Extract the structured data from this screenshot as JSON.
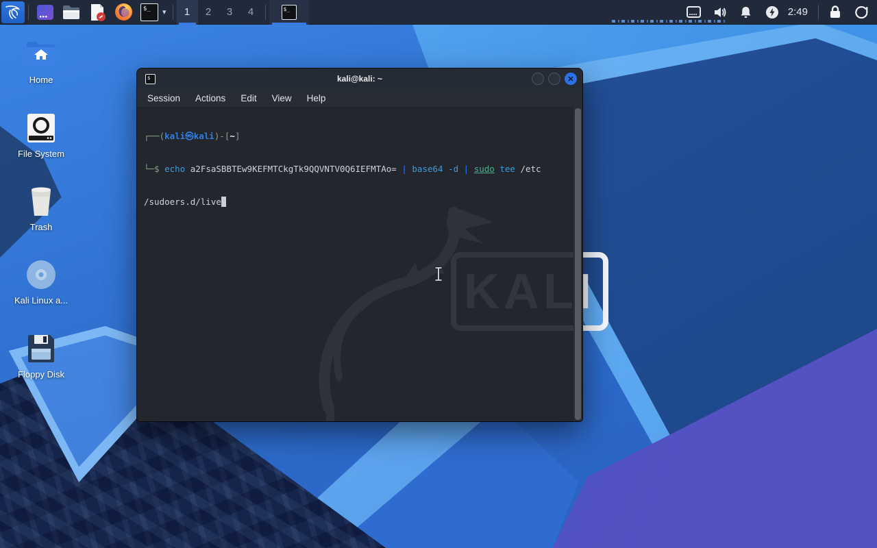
{
  "theme": {
    "panel_bg": "#212a3a",
    "accent_blue": "#3b79e8",
    "terminal_bg": "#23262d",
    "prompt_frame_color": "#85a287",
    "prompt_user_color": "#2f7fe0",
    "command_color": "#3f9bdc",
    "pipe_color": "#2563e0",
    "sudo_color": "#4fae8d",
    "wallpaper_blue": "#3173d3"
  },
  "panel": {
    "launchers": [
      {
        "name": "kali-menu"
      },
      {
        "name": "app-window"
      },
      {
        "name": "file-manager"
      },
      {
        "name": "text-editor"
      },
      {
        "name": "firefox"
      },
      {
        "name": "terminal"
      }
    ],
    "terminal_glyph": "$_",
    "workspaces": {
      "items": [
        {
          "label": "1"
        },
        {
          "label": "2"
        },
        {
          "label": "3"
        },
        {
          "label": "4"
        }
      ],
      "active": "1"
    },
    "clock": "2:49",
    "tray": [
      "network",
      "volume",
      "notifications",
      "power-manager",
      "lock",
      "logout"
    ]
  },
  "desktop": {
    "icons": [
      {
        "label": "Home"
      },
      {
        "label": "File System"
      },
      {
        "label": "Trash"
      },
      {
        "label": "Kali Linux a..."
      },
      {
        "label": "Floppy Disk"
      }
    ]
  },
  "window": {
    "title": "kali@kali: ~",
    "icon_glyph": "$",
    "menu": [
      {
        "label": "Session"
      },
      {
        "label": "Actions"
      },
      {
        "label": "Edit"
      },
      {
        "label": "View"
      },
      {
        "label": "Help"
      }
    ]
  },
  "terminal": {
    "lines": [
      {
        "segments": [
          {
            "text": "┌──(",
            "style": "frame"
          },
          {
            "text": "kali㉿kali",
            "style": "user"
          },
          {
            "text": ")-[",
            "style": "frame"
          },
          {
            "text": "~",
            "style": "dir"
          },
          {
            "text": "]",
            "style": "frame"
          }
        ]
      },
      {
        "segments": [
          {
            "text": "└─",
            "style": "frame"
          },
          {
            "text": "$ ",
            "style": "frame"
          },
          {
            "text": "echo ",
            "style": "cmd"
          },
          {
            "text": "a2FsaSBBTEw9KEFMTCkgTk9QQVNTV0Q6IEFMTAo= ",
            "style": "plain"
          },
          {
            "text": "| ",
            "style": "pipe"
          },
          {
            "text": "base64",
            "style": "cmd"
          },
          {
            "text": " -d ",
            "style": "cmd"
          },
          {
            "text": "| ",
            "style": "pipe"
          },
          {
            "text": "sudo",
            "style": "sudo"
          },
          {
            "text": " ",
            "style": "plain"
          },
          {
            "text": "tee",
            "style": "cmd"
          },
          {
            "text": " /etc",
            "style": "plain"
          }
        ]
      },
      {
        "segments": [
          {
            "text": "/sudoers.d/live",
            "style": "plain"
          },
          {
            "text": " ",
            "style": "cursor"
          }
        ]
      }
    ]
  },
  "watermark": {
    "text": "KALI"
  }
}
